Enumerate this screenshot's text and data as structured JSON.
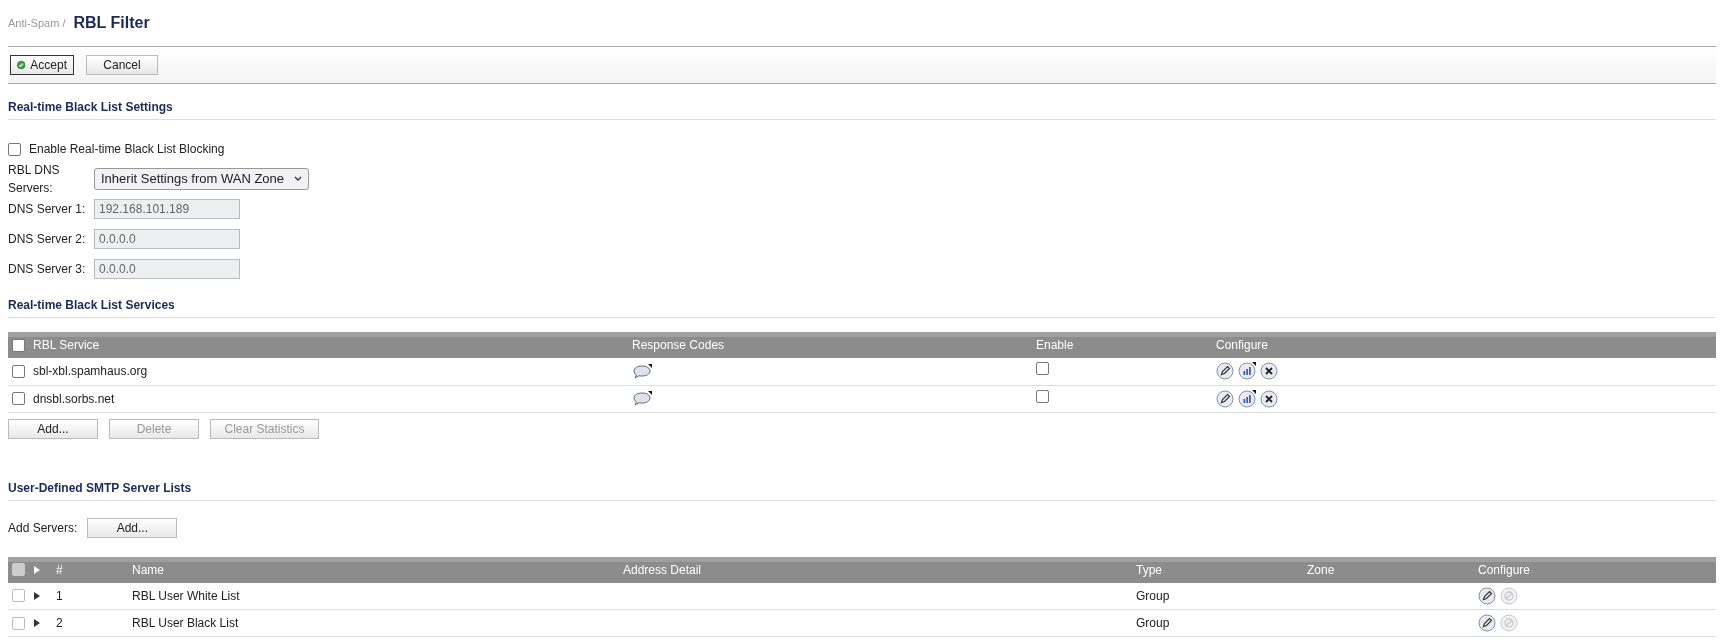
{
  "breadcrumb": "Anti-Spam /",
  "title": "RBL Filter",
  "toolbar": {
    "buttons": [
      {
        "label": "Accept",
        "kind": "accept"
      },
      {
        "label": "Cancel",
        "kind": "plain"
      }
    ]
  },
  "settings": {
    "heading": "Real-time Black List Settings",
    "enable": {
      "label": "Enable Real-time Black List Blocking",
      "checked": false
    },
    "dns_mode": {
      "label": "RBL DNS Servers:",
      "value": "Inherit Settings from WAN Zone"
    },
    "dns_servers": [
      {
        "label": "DNS Server 1:",
        "value": "192.168.101.189",
        "disabled": true
      },
      {
        "label": "DNS Server 2:",
        "value": "0.0.0.0",
        "disabled": true
      },
      {
        "label": "DNS Server 3:",
        "value": "0.0.0.0",
        "disabled": true
      }
    ]
  },
  "services": {
    "heading": "Real-time Black List Services",
    "header_checkbox": {
      "checked": false
    },
    "columns": [
      "RBL Service",
      "Response Codes",
      "Enable",
      "Configure"
    ],
    "rows": [
      {
        "service": "sbl-xbl.spamhaus.org",
        "checked": false,
        "enabled": false
      },
      {
        "service": "dnsbl.sorbs.net",
        "checked": false,
        "enabled": false
      }
    ],
    "buttons": [
      {
        "label": "Add...",
        "disabled": false
      },
      {
        "label": "Delete",
        "disabled": true
      },
      {
        "label": "Clear Statistics",
        "disabled": true
      }
    ]
  },
  "smtp": {
    "heading": "User-Defined SMTP Server Lists",
    "add_label": "Add Servers:",
    "add_button": "Add...",
    "header_checkbox": {
      "checked": false,
      "disabled": true
    },
    "columns": [
      "#",
      "Name",
      "Address Detail",
      "Type",
      "Zone",
      "Configure"
    ],
    "rows": [
      {
        "number": "1",
        "name": "RBL User White List",
        "type": "Group",
        "checked": false,
        "expanded": false,
        "delete_disabled": true
      },
      {
        "number": "2",
        "name": "RBL User Black List",
        "type": "Group",
        "checked": false,
        "expanded": false,
        "delete_disabled": true
      }
    ]
  }
}
